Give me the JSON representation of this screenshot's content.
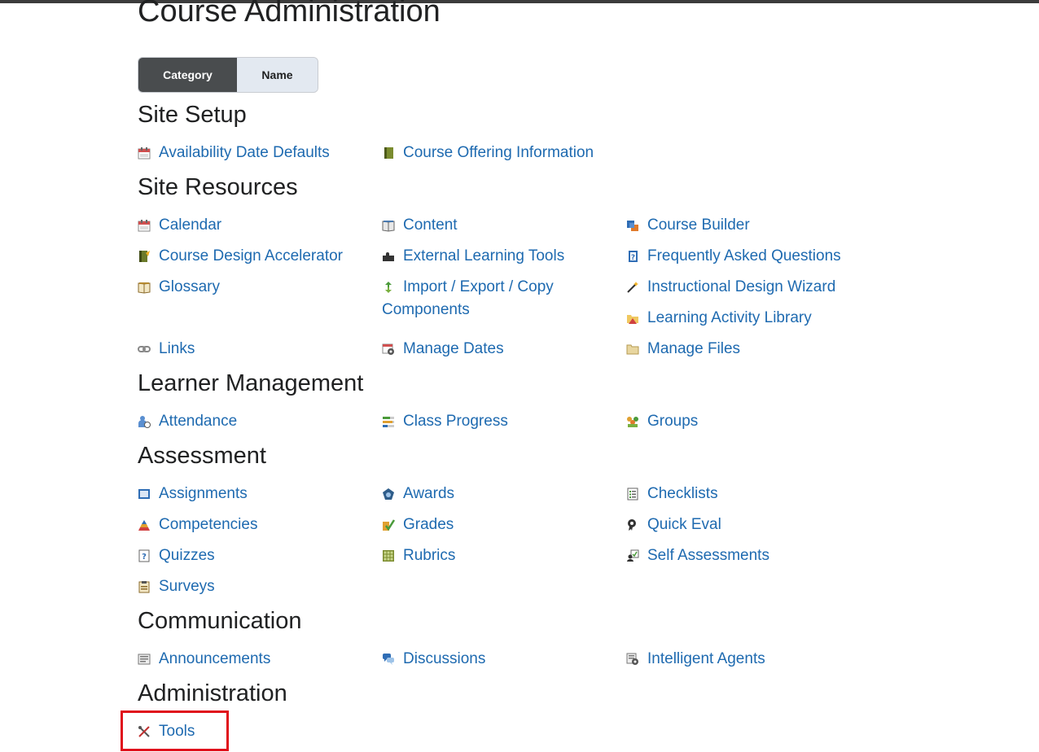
{
  "page": {
    "title": "Course Administration",
    "view_toggle": {
      "category_label": "Category",
      "name_label": "Name",
      "selected": "Category"
    }
  },
  "sections": {
    "site_setup": {
      "heading": "Site Setup",
      "links": [
        {
          "label": "Availability Date Defaults",
          "icon": "calendar-icon"
        },
        {
          "label": "Course Offering Information",
          "icon": "book-icon"
        }
      ]
    },
    "site_resources": {
      "heading": "Site Resources",
      "links": [
        {
          "label": "Calendar",
          "icon": "calendar-icon"
        },
        {
          "label": "Content",
          "icon": "open-book-icon"
        },
        {
          "label": "Course Builder",
          "icon": "course-builder-icon"
        },
        {
          "label": "Course Design Accelerator",
          "icon": "design-accelerator-icon"
        },
        {
          "label": "External Learning Tools",
          "icon": "puzzle-icon"
        },
        {
          "label": "Frequently Asked Questions",
          "icon": "faq-icon"
        },
        {
          "label": "Glossary",
          "icon": "glossary-icon"
        },
        {
          "label": "Import / Export / Copy",
          "label_line2": "Components",
          "icon": "import-export-icon"
        },
        {
          "label": "Instructional Design Wizard",
          "icon": "wand-icon"
        },
        {
          "label": "Learning Activity Library",
          "icon": "activity-library-icon"
        },
        {
          "label": "Links",
          "icon": "chain-link-icon"
        },
        {
          "label": "Manage Dates",
          "icon": "calendar-gear-icon"
        },
        {
          "label": "Manage Files",
          "icon": "folder-icon"
        }
      ]
    },
    "learner_management": {
      "heading": "Learner Management",
      "links": [
        {
          "label": "Attendance",
          "icon": "attendance-icon"
        },
        {
          "label": "Class Progress",
          "icon": "progress-icon"
        },
        {
          "label": "Groups",
          "icon": "groups-icon"
        }
      ]
    },
    "assessment": {
      "heading": "Assessment",
      "links": [
        {
          "label": "Assignments",
          "icon": "assignments-icon"
        },
        {
          "label": "Awards",
          "icon": "award-icon"
        },
        {
          "label": "Checklists",
          "icon": "checklist-icon"
        },
        {
          "label": "Competencies",
          "icon": "competencies-icon"
        },
        {
          "label": "Grades",
          "icon": "grades-icon"
        },
        {
          "label": "Quick Eval",
          "icon": "quick-eval-icon"
        },
        {
          "label": "Quizzes",
          "icon": "quiz-icon"
        },
        {
          "label": "Rubrics",
          "icon": "rubric-icon"
        },
        {
          "label": "Self Assessments",
          "icon": "self-assessment-icon"
        },
        {
          "label": "Surveys",
          "icon": "clipboard-icon"
        }
      ]
    },
    "communication": {
      "heading": "Communication",
      "links": [
        {
          "label": "Announcements",
          "icon": "announcement-icon"
        },
        {
          "label": "Discussions",
          "icon": "chat-bubbles-icon"
        },
        {
          "label": "Intelligent Agents",
          "icon": "agent-icon"
        }
      ]
    },
    "administration": {
      "heading": "Administration",
      "links": [
        {
          "label": "Tools",
          "icon": "tools-icon"
        }
      ]
    }
  },
  "colors": {
    "link": "#1e6ab0",
    "heading": "#202122",
    "toggle_active": "#494c4e",
    "highlight": "#e0101c"
  }
}
